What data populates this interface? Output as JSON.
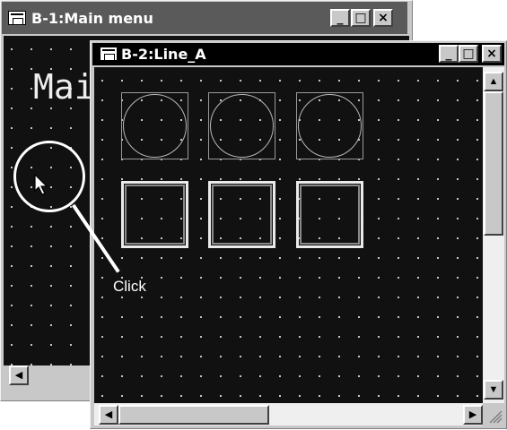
{
  "windows": {
    "main_menu": {
      "title": "B-1:Main menu",
      "canvas_text": "Mai",
      "minimize_glyph": "_",
      "maximize_glyph": "□",
      "close_glyph": "×",
      "scroll_left_glyph": "◀"
    },
    "line_a": {
      "title": "B-2:Line_A",
      "minimize_glyph": "_",
      "maximize_glyph": "□",
      "close_glyph": "×",
      "scroll_up_glyph": "▲",
      "scroll_down_glyph": "▼",
      "scroll_left_glyph": "◀",
      "scroll_right_glyph": "▶",
      "lamps": [
        "circle",
        "circle",
        "circle"
      ],
      "switches": [
        "square",
        "square",
        "square"
      ]
    }
  },
  "annotation": {
    "label": "Click"
  },
  "icons": {
    "title_icon": "screen-app-icon",
    "pointer": "mouse-pointer-icon"
  },
  "colors": {
    "canvas_background": "#111111",
    "title_bar_active": "#000000",
    "title_bar_inactive": "#5a5a5a",
    "chrome": "#c8c8c8"
  }
}
